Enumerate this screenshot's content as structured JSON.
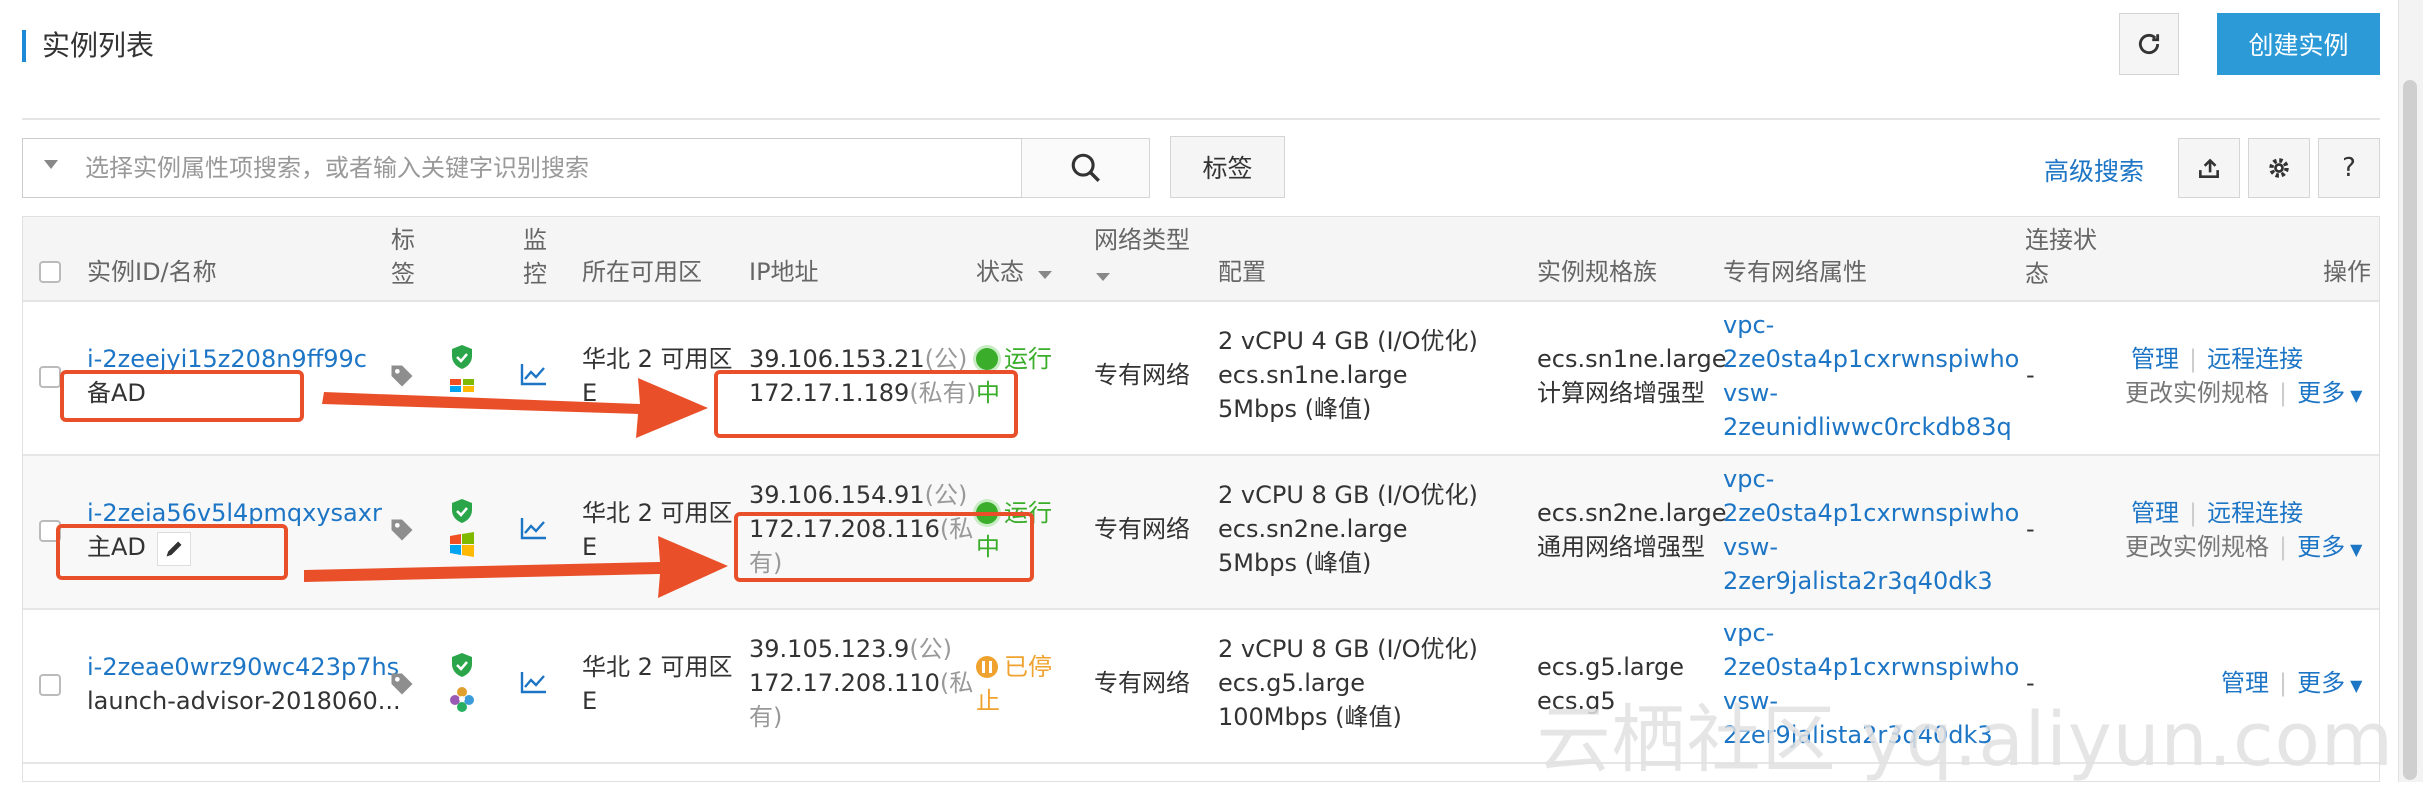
{
  "header": {
    "title": "实例列表",
    "create_label": "创建实例"
  },
  "toolbar": {
    "search_placeholder": "选择实例属性项搜索，或者输入关键字识别搜索",
    "tag_label": "标签",
    "advanced_search": "高级搜索",
    "help_label": "?"
  },
  "columns": {
    "id_name": "实例ID/名称",
    "tag_l1": "标",
    "tag_l2": "签",
    "monitor_l1": "监",
    "monitor_l2": "控",
    "zone": "所在可用区",
    "ip": "IP地址",
    "status": "状态",
    "network_l1": "网络类型",
    "config": "配置",
    "family": "实例规格族",
    "vpc": "专有网络属性",
    "conn_l1": "连接状",
    "conn_l2": "态",
    "ops": "操作"
  },
  "rows": [
    {
      "id": "i-2zeejyi15z208n9ff99c",
      "name": "备AD",
      "zone_l1": "华北 2 可用区",
      "zone_l2": "E",
      "public_ip": "39.106.153.21",
      "public_tag": "(公)",
      "private_ip": "172.17.1.189",
      "private_tag": "(私有)",
      "status_l1": "运行",
      "status_l2": "中",
      "network": "专有网络",
      "config_l1": "2 vCPU 4 GB (I/O优化)",
      "config_l2": "ecs.sn1ne.large",
      "config_l3": "5Mbps (峰值)",
      "family_l1": "ecs.sn1ne.large",
      "family_l2": "计算网络增强型",
      "vpc_l1": "vpc-",
      "vpc_l2": "2ze0sta4p1cxrwnspiwho",
      "vpc_l3": "vsw-",
      "vpc_l4": "2zeunidliwwc0rckdb83q",
      "conn": "-",
      "op_manage": "管理",
      "op_remote": "远程连接",
      "op_change": "更改实例规格",
      "op_more": "更多"
    },
    {
      "id": "i-2zeia56v5l4pmqxysaxr",
      "name": "主AD",
      "zone_l1": "华北 2 可用区",
      "zone_l2": "E",
      "public_ip": "39.106.154.91",
      "public_tag": "(公)",
      "private_ip": "172.17.208.116",
      "private_tag": "(私",
      "private_tag2": "有)",
      "status_l1": "运行",
      "status_l2": "中",
      "network": "专有网络",
      "config_l1": "2 vCPU 8 GB (I/O优化)",
      "config_l2": "ecs.sn2ne.large",
      "config_l3": "5Mbps (峰值)",
      "family_l1": "ecs.sn2ne.large",
      "family_l2": "通用网络增强型",
      "vpc_l1": "vpc-",
      "vpc_l2": "2ze0sta4p1cxrwnspiwho",
      "vpc_l3": "vsw-",
      "vpc_l4": "2zer9jalista2r3q40dk3",
      "conn": "-",
      "op_manage": "管理",
      "op_remote": "远程连接",
      "op_change": "更改实例规格",
      "op_more": "更多"
    },
    {
      "id": "i-2zeae0wrz90wc423p7hs",
      "name": "launch-advisor-2018060...",
      "zone_l1": "华北 2 可用区",
      "zone_l2": "E",
      "public_ip": "39.105.123.9",
      "public_tag": "(公)",
      "private_ip": "172.17.208.110",
      "private_tag": "(私",
      "private_tag2": "有)",
      "status_l1": "已停",
      "status_l2": "止",
      "network": "专有网络",
      "config_l1": "2 vCPU 8 GB (I/O优化)",
      "config_l2": "ecs.g5.large",
      "config_l3": "100Mbps (峰值)",
      "family_l1": "ecs.g5.large",
      "family_l2": "ecs.g5",
      "vpc_l1": "vpc-",
      "vpc_l2": "2ze0sta4p1cxrwnspiwho",
      "vpc_l3": "vsw-",
      "vpc_l4": "2zer9jalista2r3q40dk3",
      "conn": "-",
      "op_manage": "管理",
      "op_more": "更多"
    }
  ],
  "watermark": "云栖社区 yq.aliyun.com",
  "colors": {
    "link": "#1d75c5",
    "primary": "#2d9ad8",
    "running": "#3aad2a",
    "stopped": "#f0a22e",
    "annotation": "#e9502a"
  },
  "icons": [
    "refresh-icon",
    "search-icon",
    "export-icon",
    "gear-icon",
    "tag-icon",
    "shield-icon",
    "windows-icon",
    "chart-icon",
    "edit-icon",
    "caret-down-icon"
  ]
}
